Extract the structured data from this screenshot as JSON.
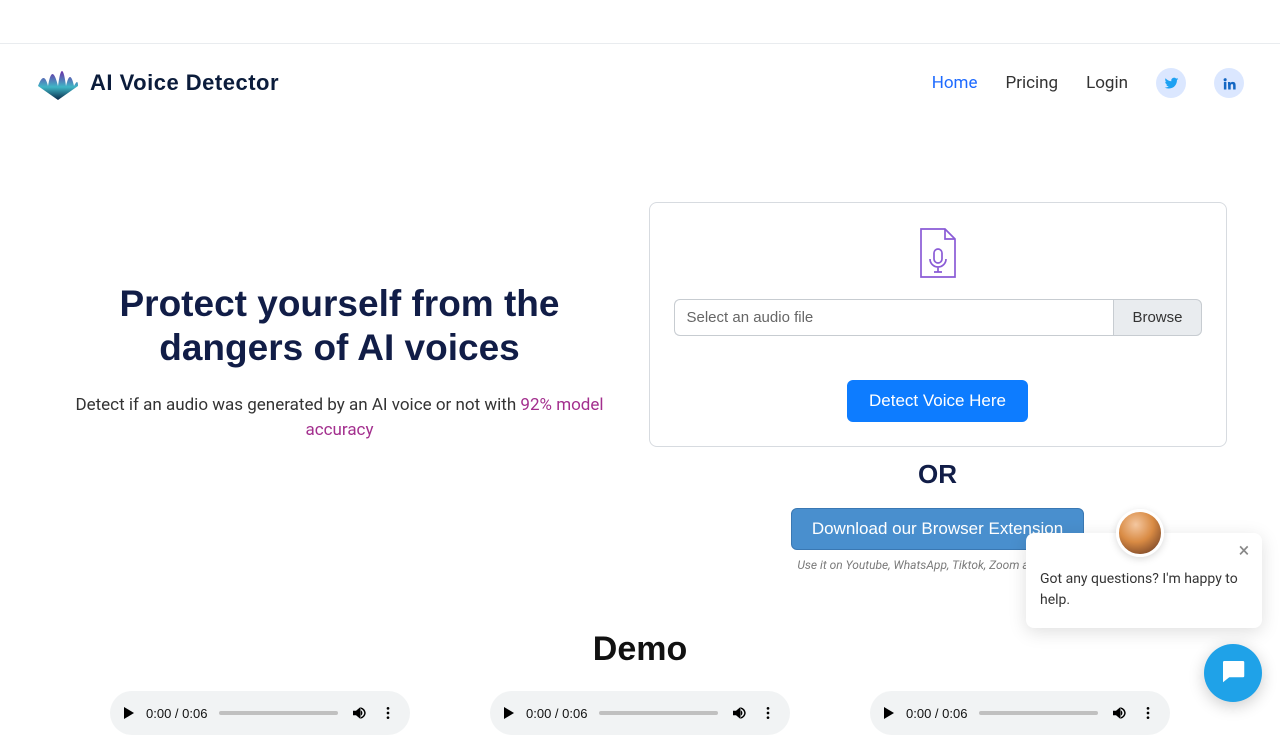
{
  "brand": {
    "name": "AI Voice Detector"
  },
  "nav": {
    "home": "Home",
    "pricing": "Pricing",
    "login": "Login"
  },
  "hero": {
    "title": "Protect yourself from the dangers of AI voices",
    "sub_before": "Detect if an audio was generated by an AI voice or not with ",
    "sub_accent": "92% model accuracy"
  },
  "upload": {
    "placeholder": "Select an audio file",
    "browse": "Browse",
    "detect": "Detect Voice Here",
    "or": "OR",
    "download": "Download our Browser Extension",
    "hint": "Use it on Youtube, WhatsApp, Tiktok, Zoom and others"
  },
  "demo": {
    "title": "Demo",
    "time": "0:00 / 0:06"
  },
  "chat": {
    "message": "Got any questions? I'm happy to help."
  }
}
